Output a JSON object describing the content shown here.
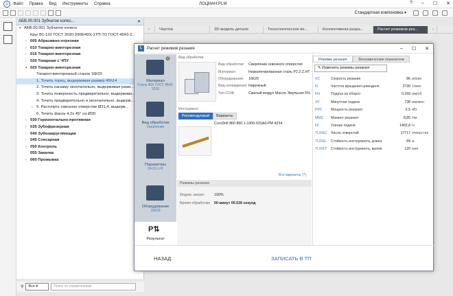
{
  "app": {
    "menu": [
      "Файл",
      "Правка",
      "Вид",
      "Инструменты",
      "Справка"
    ],
    "title": "ЛОЦМАН:PLM",
    "layout": "Стандартная компоновка"
  },
  "tree": {
    "tab": "АБВ.00.001 Зубчатое колес...",
    "rows": [
      {
        "t": "АБВ.00.001 Зубчатое колесо",
        "ind": 0,
        "arr": "▾",
        "bold": false
      },
      {
        "t": "Круг В1-120 ГОСТ 2590-2006/40Х-1ТП-ТО ГОСТ 4543-2...",
        "ind": 1,
        "arr": "",
        "bold": false
      },
      {
        "t": "005 Абразивно-отрезная",
        "ind": 1,
        "arr": "›",
        "bold": true
      },
      {
        "t": "010 Токарно-винторезная",
        "ind": 1,
        "arr": "›",
        "bold": true
      },
      {
        "t": "015 Токарно-винторезная",
        "ind": 1,
        "arr": "›",
        "bold": true
      },
      {
        "t": "020 Токарная с ЧПУ",
        "ind": 1,
        "arr": "›",
        "bold": true
      },
      {
        "t": "025 Токарно-винторезная",
        "ind": 1,
        "arr": "▾",
        "bold": true
      },
      {
        "t": "Токарно-винторезный станок 16К20",
        "ind": 2,
        "arr": "",
        "bold": false
      },
      {
        "t": "1. Точить торец, выдерживая размер 45h14",
        "ind": 2,
        "arr": "",
        "bold": false,
        "sel": true
      },
      {
        "t": "2. Точить канавку окончательно, выдерживая разм...",
        "ind": 2,
        "arr": "",
        "bold": false
      },
      {
        "t": "3. Точить поверхность предварительно, выдержива...",
        "ind": 2,
        "arr": "",
        "bold": false
      },
      {
        "t": "4. Точить предварительно и окончательно, выдерж...",
        "ind": 2,
        "arr": "",
        "bold": false
      },
      {
        "t": "5. Расточить сквозное отверстие Ø31,4, выдерж...",
        "ind": 2,
        "arr": "›",
        "bold": false
      },
      {
        "t": "6. Точить фаску 4,2х 45° на Ø30",
        "ind": 2,
        "arr": "",
        "bold": false
      },
      {
        "t": "030 Горизонтально-протяжная",
        "ind": 1,
        "arr": "›",
        "bold": true
      },
      {
        "t": "035 Зубофрезерная",
        "ind": 1,
        "arr": "›",
        "bold": true
      },
      {
        "t": "040 Зубозакругляющая",
        "ind": 1,
        "arr": "›",
        "bold": true
      },
      {
        "t": "045 Слесарная",
        "ind": 1,
        "arr": "›",
        "bold": true
      },
      {
        "t": "050 Контроль",
        "ind": 1,
        "arr": "›",
        "bold": true
      },
      {
        "t": "055 Закалка",
        "ind": 1,
        "arr": "",
        "bold": true
      },
      {
        "t": "060 Промывка",
        "ind": 1,
        "arr": "›",
        "bold": true
      }
    ]
  },
  "search": {
    "btn": "Все",
    "placeholder": "Поиск по справочникам"
  },
  "doctabs": [
    "Чертёж",
    "3D-модель детали",
    "Технологическая ве...",
    "Коллективная разра...",
    "Расчет режимов рез..."
  ],
  "dialog": {
    "title": "Расчет режимов резания",
    "steps": [
      {
        "name": "Материал",
        "sub": "Сталь 40Х ГОСТ 4543-2016"
      },
      {
        "name": "Вид обработки",
        "sub": "Сверление"
      },
      {
        "name": "Параметры",
        "sub": "D=10 L=5"
      },
      {
        "name": "Оборудование",
        "sub": "16К20"
      },
      {
        "name": "Результат",
        "sub": ""
      }
    ],
    "proc_header": "Вид обработки",
    "proc": [
      {
        "k": "Вид обработки:",
        "v": "Сверление сквозного отверстия"
      },
      {
        "k": "Материал:",
        "v": "Низколегированная сталь P2.2.Z.HT"
      },
      {
        "k": "Оборудование:",
        "v": "16К20"
      },
      {
        "k": "Вид охлаждения:",
        "v": "Наружный"
      },
      {
        "k": "Тип СОЖ:",
        "v": "Сжатый воздух Масло Эмульсия 5%"
      }
    ],
    "tool_header": "Инструмент",
    "tool_tabs": [
      "Рекомендуемый",
      "Варианты"
    ],
    "tool_name": "CoroDrill 860 860.1-1000-031A0-PM 4234",
    "variants_link": "Все варианты (7)",
    "mode_header": "Режимы резания",
    "mode": [
      {
        "k": "Индекс затрат:",
        "v": "100%"
      },
      {
        "k": "Время обработки:",
        "v": "00 минут 00.536 секунд"
      }
    ],
    "rtabs": [
      "Режимы резания",
      "Экономические показатели"
    ],
    "change_btn": "Изменить режимы резания",
    "params": [
      {
        "k": "VC",
        "n": "Скорость резания",
        "v": "86",
        "u": "м/мин"
      },
      {
        "k": "N",
        "n": "Частота вращения шпинделя",
        "v": "2739",
        "u": "1/мин"
      },
      {
        "k": "FN",
        "n": "Подача на оборот",
        "v": "0,269",
        "u": "мм/об"
      },
      {
        "k": "VF",
        "n": "Минутная подача",
        "v": "738",
        "u": "мм/мин"
      },
      {
        "k": "PPC",
        "n": "Мощность резания",
        "v": "2,5",
        "u": "кВт"
      },
      {
        "k": "MMC",
        "n": "Момент резания",
        "v": "8,85",
        "u": "Нм"
      },
      {
        "k": "FF",
        "n": "Усилие подачи",
        "v": "1402,8",
        "u": "Н"
      },
      {
        "k": "TLIFEC",
        "n": "Число отверстий",
        "v": "17717",
        "u": "отверстия"
      },
      {
        "k": "TLIFEL",
        "n": "Стойкость инструмента, длина",
        "v": "89",
        "u": "м"
      },
      {
        "k": "TLIFET",
        "n": "Стойкость инструмента, время",
        "v": "120",
        "u": "мин"
      }
    ],
    "back": "НАЗАД",
    "submit": "ЗАПИСАТЬ В ТП"
  }
}
